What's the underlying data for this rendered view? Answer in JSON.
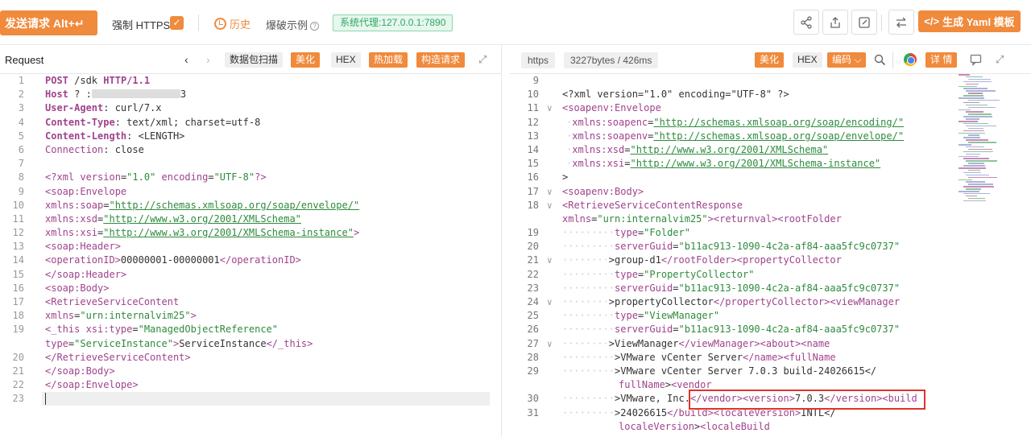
{
  "toolbar": {
    "send_label": "发送请求 Alt+↵",
    "https_label": "强制 HTTPS",
    "history_label": "历史",
    "examples_label": "爆破示例",
    "proxy_label": "系统代理:127.0.0.1:7890",
    "yaml_label": "生成 Yaml 模板"
  },
  "request": {
    "title": "Request",
    "tools": [
      "数据包扫描",
      "美化",
      "HEX",
      "热加载",
      "构造请求"
    ],
    "lines": [
      {
        "n": "1",
        "parts": [
          [
            "kw",
            "POST"
          ],
          [
            "txt",
            " /sdk "
          ],
          [
            "kw",
            "HTTP/1.1"
          ]
        ]
      },
      {
        "n": "2",
        "parts": [
          [
            "hdr",
            "Host"
          ],
          [
            "txt",
            " ? :"
          ],
          [
            "redact",
            ""
          ],
          [
            "txt",
            "3"
          ]
        ]
      },
      {
        "n": "3",
        "parts": [
          [
            "hdr",
            "User-Agent"
          ],
          [
            "txt",
            ": curl/7.x"
          ]
        ]
      },
      {
        "n": "4",
        "parts": [
          [
            "hdr",
            "Content-Type"
          ],
          [
            "txt",
            ": text/xml; charset=utf-8"
          ]
        ]
      },
      {
        "n": "5",
        "parts": [
          [
            "hdr",
            "Content-Length"
          ],
          [
            "txt",
            ": <LENGTH>"
          ]
        ]
      },
      {
        "n": "6",
        "parts": [
          [
            "tag",
            "Connection"
          ],
          [
            "txt",
            ": close"
          ]
        ]
      },
      {
        "n": "7",
        "parts": []
      },
      {
        "n": "8",
        "parts": [
          [
            "tag",
            "<?xml "
          ],
          [
            "tag",
            "version"
          ],
          [
            "txt",
            "="
          ],
          [
            "str",
            "\"1.0\""
          ],
          [
            "tag",
            " encoding"
          ],
          [
            "txt",
            "="
          ],
          [
            "str",
            "\"UTF-8\""
          ],
          [
            "tag",
            "?>"
          ]
        ]
      },
      {
        "n": "9",
        "parts": [
          [
            "tag",
            "<soap:Envelope"
          ]
        ]
      },
      {
        "n": "10",
        "parts": [
          [
            "tag",
            "xmlns:soap"
          ],
          [
            "txt",
            "="
          ],
          [
            "url",
            "\"http://schemas.xmlsoap.org/soap/envelope/\""
          ]
        ]
      },
      {
        "n": "11",
        "parts": [
          [
            "tag",
            "xmlns:xsd"
          ],
          [
            "txt",
            "="
          ],
          [
            "url",
            "\"http://www.w3.org/2001/XMLSchema\""
          ]
        ]
      },
      {
        "n": "12",
        "parts": [
          [
            "tag",
            "xmlns:xsi"
          ],
          [
            "txt",
            "="
          ],
          [
            "url",
            "\"http://www.w3.org/2001/XMLSchema-instance\""
          ],
          [
            "tag",
            ">"
          ]
        ]
      },
      {
        "n": "13",
        "parts": [
          [
            "tag",
            "<soap:Header>"
          ]
        ]
      },
      {
        "n": "14",
        "parts": [
          [
            "tag",
            "<operationID>"
          ],
          [
            "txt",
            "00000001-00000001"
          ],
          [
            "tag",
            "</operationID>"
          ]
        ]
      },
      {
        "n": "15",
        "parts": [
          [
            "tag",
            "</soap:Header>"
          ]
        ]
      },
      {
        "n": "16",
        "parts": [
          [
            "tag",
            "<soap:Body>"
          ]
        ]
      },
      {
        "n": "17",
        "parts": [
          [
            "tag",
            "<RetrieveServiceContent"
          ]
        ]
      },
      {
        "n": "18",
        "parts": [
          [
            "tag",
            "xmlns"
          ],
          [
            "txt",
            "="
          ],
          [
            "str",
            "\"urn:internalvim25\""
          ],
          [
            "tag",
            ">"
          ]
        ]
      },
      {
        "n": "19",
        "parts": [
          [
            "tag",
            "<_this "
          ],
          [
            "tag",
            "xsi:type"
          ],
          [
            "txt",
            "="
          ],
          [
            "str",
            "\"ManagedObjectReference\""
          ]
        ]
      },
      {
        "n": "",
        "parts": [
          [
            "tag",
            "type"
          ],
          [
            "txt",
            "="
          ],
          [
            "str",
            "\"ServiceInstance\""
          ],
          [
            "tag",
            ">"
          ],
          [
            "txt",
            "ServiceInstance"
          ],
          [
            "tag",
            "</_this>"
          ]
        ]
      },
      {
        "n": "20",
        "parts": [
          [
            "tag",
            "</RetrieveServiceContent>"
          ]
        ]
      },
      {
        "n": "21",
        "parts": [
          [
            "tag",
            "</soap:Body>"
          ]
        ]
      },
      {
        "n": "22",
        "parts": [
          [
            "tag",
            "</soap:Envelope>"
          ]
        ]
      },
      {
        "n": "23",
        "parts": []
      }
    ]
  },
  "response": {
    "protocol": "https",
    "size": "3227bytes / 426ms",
    "tools": [
      "美化",
      "HEX",
      "编码",
      "详 情"
    ],
    "lines": [
      {
        "n": "9",
        "fold": "",
        "ind": 0,
        "parts": []
      },
      {
        "n": "10",
        "fold": "",
        "ind": 0,
        "parts": [
          [
            "txt",
            "<?xml version=\"1.0\" encoding=\"UTF-8\" ?>"
          ]
        ]
      },
      {
        "n": "11",
        "fold": "∨",
        "ind": 0,
        "parts": [
          [
            "tag",
            "<soapenv:Envelope"
          ]
        ]
      },
      {
        "n": "12",
        "fold": "",
        "ind": 1,
        "parts": [
          [
            "tag",
            "xmlns:soapenc"
          ],
          [
            "txt",
            "="
          ],
          [
            "url",
            "\"http://schemas.xmlsoap.org/soap/encoding/\""
          ]
        ]
      },
      {
        "n": "13",
        "fold": "",
        "ind": 1,
        "parts": [
          [
            "tag",
            "xmlns:soapenv"
          ],
          [
            "txt",
            "="
          ],
          [
            "url",
            "\"http://schemas.xmlsoap.org/soap/envelope/\""
          ]
        ]
      },
      {
        "n": "14",
        "fold": "",
        "ind": 1,
        "parts": [
          [
            "tag",
            "xmlns:xsd"
          ],
          [
            "txt",
            "="
          ],
          [
            "url",
            "\"http://www.w3.org/2001/XMLSchema\""
          ]
        ]
      },
      {
        "n": "15",
        "fold": "",
        "ind": 1,
        "parts": [
          [
            "tag",
            "xmlns:xsi"
          ],
          [
            "txt",
            "="
          ],
          [
            "url",
            "\"http://www.w3.org/2001/XMLSchema-instance\""
          ]
        ]
      },
      {
        "n": "16",
        "fold": "",
        "ind": 0,
        "parts": [
          [
            "txt",
            ">"
          ]
        ]
      },
      {
        "n": "17",
        "fold": "∨",
        "ind": 0,
        "parts": [
          [
            "tag",
            "<soapenv:Body>"
          ]
        ]
      },
      {
        "n": "18",
        "fold": "∨",
        "ind": 0,
        "parts": [
          [
            "tag",
            "<RetrieveServiceContentResponse"
          ]
        ]
      },
      {
        "n": "",
        "fold": "",
        "ind": 0,
        "parts": [
          [
            "tag",
            "xmlns"
          ],
          [
            "txt",
            "="
          ],
          [
            "str",
            "\"urn:internalvim25\""
          ],
          [
            "tag",
            ">"
          ],
          [
            "tag",
            "<returnval>"
          ],
          [
            "tag",
            "<rootFolder"
          ]
        ]
      },
      {
        "n": "19",
        "fold": "",
        "ind": 3,
        "parts": [
          [
            "tag",
            "type"
          ],
          [
            "txt",
            "="
          ],
          [
            "str",
            "\"Folder\""
          ]
        ]
      },
      {
        "n": "20",
        "fold": "",
        "ind": 3,
        "parts": [
          [
            "tag",
            "serverGuid"
          ],
          [
            "txt",
            "="
          ],
          [
            "str",
            "\"b11ac913-1090-4c2a-af84-aaa5fc9c0737\""
          ]
        ]
      },
      {
        "n": "21",
        "fold": "∨",
        "ind": 2,
        "parts": [
          [
            "txt",
            ">group-d1"
          ],
          [
            "tag",
            "</rootFolder>"
          ],
          [
            "tag",
            "<propertyCollector"
          ]
        ]
      },
      {
        "n": "22",
        "fold": "",
        "ind": 3,
        "parts": [
          [
            "tag",
            "type"
          ],
          [
            "txt",
            "="
          ],
          [
            "str",
            "\"PropertyCollector\""
          ]
        ]
      },
      {
        "n": "23",
        "fold": "",
        "ind": 3,
        "parts": [
          [
            "tag",
            "serverGuid"
          ],
          [
            "txt",
            "="
          ],
          [
            "str",
            "\"b11ac913-1090-4c2a-af84-aaa5fc9c0737\""
          ]
        ]
      },
      {
        "n": "24",
        "fold": "∨",
        "ind": 2,
        "parts": [
          [
            "txt",
            ">propertyCollector"
          ],
          [
            "tag",
            "</propertyCollector>"
          ],
          [
            "tag",
            "<viewManager"
          ]
        ]
      },
      {
        "n": "25",
        "fold": "",
        "ind": 3,
        "parts": [
          [
            "tag",
            "type"
          ],
          [
            "txt",
            "="
          ],
          [
            "str",
            "\"ViewManager\""
          ]
        ]
      },
      {
        "n": "26",
        "fold": "",
        "ind": 3,
        "parts": [
          [
            "tag",
            "serverGuid"
          ],
          [
            "txt",
            "="
          ],
          [
            "str",
            "\"b11ac913-1090-4c2a-af84-aaa5fc9c0737\""
          ]
        ]
      },
      {
        "n": "27",
        "fold": "∨",
        "ind": 2,
        "parts": [
          [
            "txt",
            ">ViewManager"
          ],
          [
            "tag",
            "</viewManager>"
          ],
          [
            "tag",
            "<about>"
          ],
          [
            "tag",
            "<name"
          ]
        ]
      },
      {
        "n": "28",
        "fold": "",
        "ind": 3,
        "parts": [
          [
            "txt",
            ">VMware vCenter Server"
          ],
          [
            "tag",
            "</name>"
          ],
          [
            "tag",
            "<fullName"
          ]
        ]
      },
      {
        "n": "29",
        "fold": "",
        "ind": 3,
        "parts": [
          [
            "txt",
            ">VMware vCenter Server 7.0.3 build-24026615</"
          ]
        ]
      },
      {
        "n": "",
        "fold": "",
        "ind": -1,
        "parts": [
          [
            "tag",
            "fullName"
          ],
          [
            "txt",
            ">"
          ],
          [
            "tag",
            "<vendor"
          ]
        ]
      },
      {
        "n": "30",
        "fold": "",
        "ind": 3,
        "parts": [
          [
            "txt",
            ">VMware, Inc."
          ],
          [
            "tag",
            "</vendor>"
          ],
          [
            "tag",
            "<version>"
          ],
          [
            "txt",
            "7.0.3"
          ],
          [
            "tag",
            "</version>"
          ],
          [
            "tag",
            "<build"
          ]
        ]
      },
      {
        "n": "31",
        "fold": "",
        "ind": 3,
        "parts": [
          [
            "txt",
            ">24026615"
          ],
          [
            "tag",
            "</build>"
          ],
          [
            "tag",
            "<localeVersion>"
          ],
          [
            "txt",
            "INTL</"
          ]
        ]
      },
      {
        "n": "",
        "fold": "",
        "ind": -1,
        "parts": [
          [
            "tag",
            "localeVersion"
          ],
          [
            "txt",
            ">"
          ],
          [
            "tag",
            "<localeBuild"
          ]
        ]
      }
    ]
  }
}
